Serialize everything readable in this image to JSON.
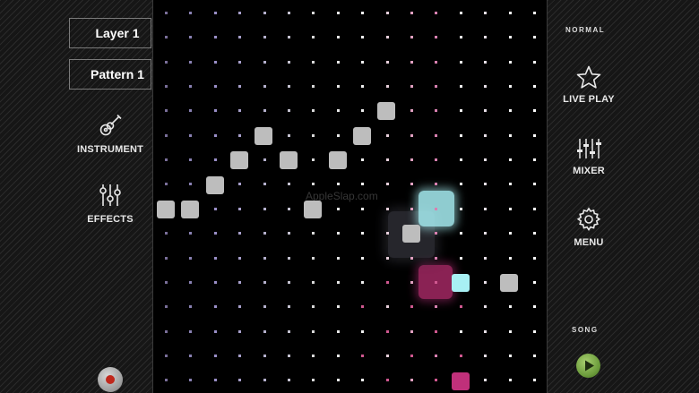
{
  "left_panel": {
    "layer_label": "Layer 1",
    "pattern_label": "Pattern 1",
    "instrument_label": "INSTRUMENT",
    "effects_label": "EFFECTS"
  },
  "right_panel": {
    "mode_label": "NORMAL",
    "live_play_label": "LIVE PLAY",
    "mixer_label": "MIXER",
    "menu_label": "MENU",
    "song_label": "SONG"
  },
  "watermark": "AppleSlap.com",
  "colors": {
    "accent_pink": "#c0307a",
    "accent_cyan": "#a8f0f4",
    "note_white": "#bdbdbd",
    "play_green": "#6a9a3a",
    "record_red": "#c0281c"
  },
  "icons": [
    "guitar-icon",
    "sliders-icon",
    "star-icon",
    "mixer-icon",
    "gear-icon",
    "play-icon",
    "record-icon"
  ]
}
